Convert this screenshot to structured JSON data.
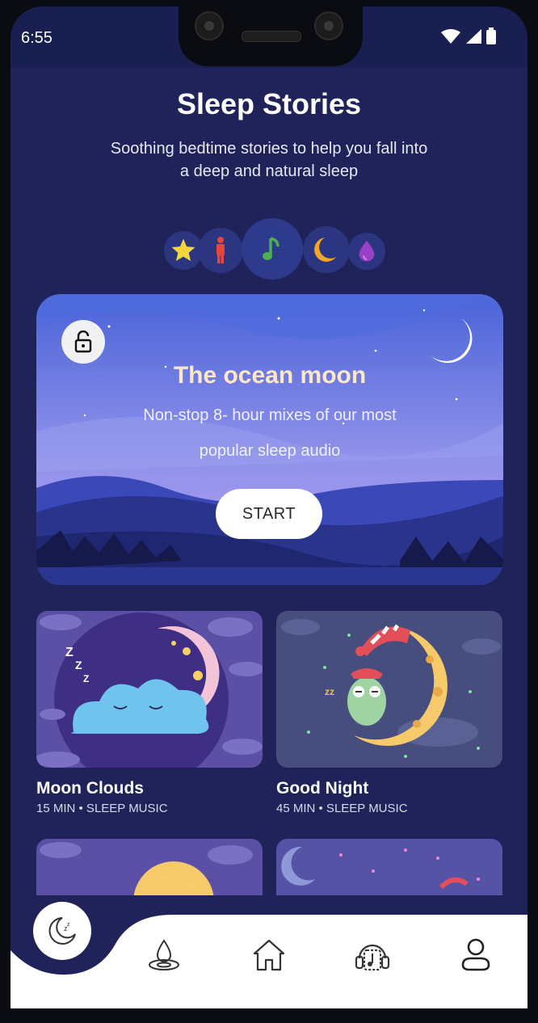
{
  "status_bar": {
    "time": "6:55"
  },
  "header": {
    "title": "Sleep Stories",
    "subtitle": "Soothing bedtime stories to help you fall into a deep and natural sleep"
  },
  "categories": [
    {
      "icon": "star-icon",
      "color": "#f4d63c"
    },
    {
      "icon": "person-icon",
      "color": "#e8453c"
    },
    {
      "icon": "music-note-icon",
      "color": "#4caf50"
    },
    {
      "icon": "moon-icon",
      "color": "#f5a623"
    },
    {
      "icon": "drop-icon",
      "color": "#9c3fc7"
    }
  ],
  "featured": {
    "title": "The ocean moon",
    "description": "Non-stop 8- hour mixes of our most popular sleep audio",
    "button_label": "START"
  },
  "stories": [
    {
      "title": "Moon Clouds",
      "meta": "15 MIN • SLEEP MUSIC"
    },
    {
      "title": "Good Night",
      "meta": "45 MIN • SLEEP MUSIC"
    }
  ],
  "nav": [
    {
      "icon": "sleep-moon-icon",
      "active": true
    },
    {
      "icon": "meditate-icon"
    },
    {
      "icon": "home-icon"
    },
    {
      "icon": "music-headphones-icon"
    },
    {
      "icon": "profile-icon"
    }
  ],
  "colors": {
    "background": "#1f2359",
    "accent_title": "#fde7c7",
    "nav_background": "#ffffff"
  }
}
